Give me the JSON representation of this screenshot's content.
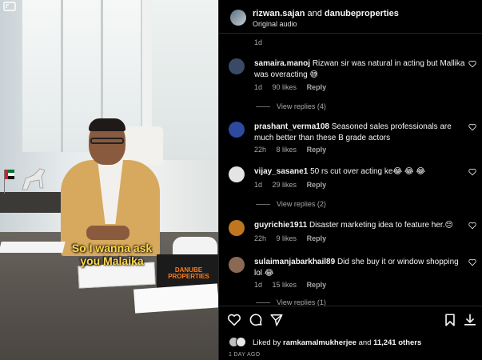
{
  "video": {
    "caption_line1": "So I wanna ask",
    "caption_line2": "you Malaika",
    "box_brand_line1": "DANUBE",
    "box_brand_line2": "PROPERTIES"
  },
  "header": {
    "user1": "rizwan.sajan",
    "connector": "and",
    "user2": "danubeproperties",
    "audio": "Original audio"
  },
  "comments": {
    "top_time": "1d",
    "items": [
      {
        "user": "samaira.manoj",
        "text": "Rizwan sir was natural in acting but Mallika was overacting 😅",
        "time": "1d",
        "likes": "90 likes",
        "reply": "Reply",
        "view_replies": "View replies (4)",
        "avatar_color": "#3a4a66"
      },
      {
        "user": "prashant_verma108",
        "text": "Seasoned sales professionals are much better than these B grade actors",
        "time": "22h",
        "likes": "8 likes",
        "reply": "Reply",
        "avatar_color": "#2b4aa0"
      },
      {
        "user": "vijay_sasane1",
        "text": "50 rs cut over acting ke😂 😂 😂",
        "time": "1d",
        "likes": "29 likes",
        "reply": "Reply",
        "view_replies": "View replies (2)",
        "avatar_color": "#e4e4e4"
      },
      {
        "user": "guyrichie1911",
        "text": "Disaster marketing idea to feature her.😔",
        "time": "22h",
        "likes": "9 likes",
        "reply": "Reply",
        "avatar_color": "#c0761f"
      },
      {
        "user": "sulaimanjabarkhail89",
        "text": "Did she buy it or window shopping lol 😂",
        "time": "1d",
        "likes": "15 likes",
        "reply": "Reply",
        "view_replies": "View replies (1)",
        "avatar_color": "#8a6a55"
      }
    ]
  },
  "actions": {
    "liked_prefix": "Liked by",
    "liked_user": "ramkamalmukherjee",
    "liked_and": "and",
    "liked_others": "11,241 others",
    "time_ago": "1 DAY AGO"
  },
  "colors": {
    "background": "#000000",
    "muted_text": "#a8a8a8",
    "caption": "#ffd84a",
    "brand_orange": "#ff7a1a"
  },
  "icons": [
    "expand-icon",
    "heart-icon",
    "comment-icon",
    "share-icon",
    "bookmark-icon",
    "download-icon"
  ]
}
